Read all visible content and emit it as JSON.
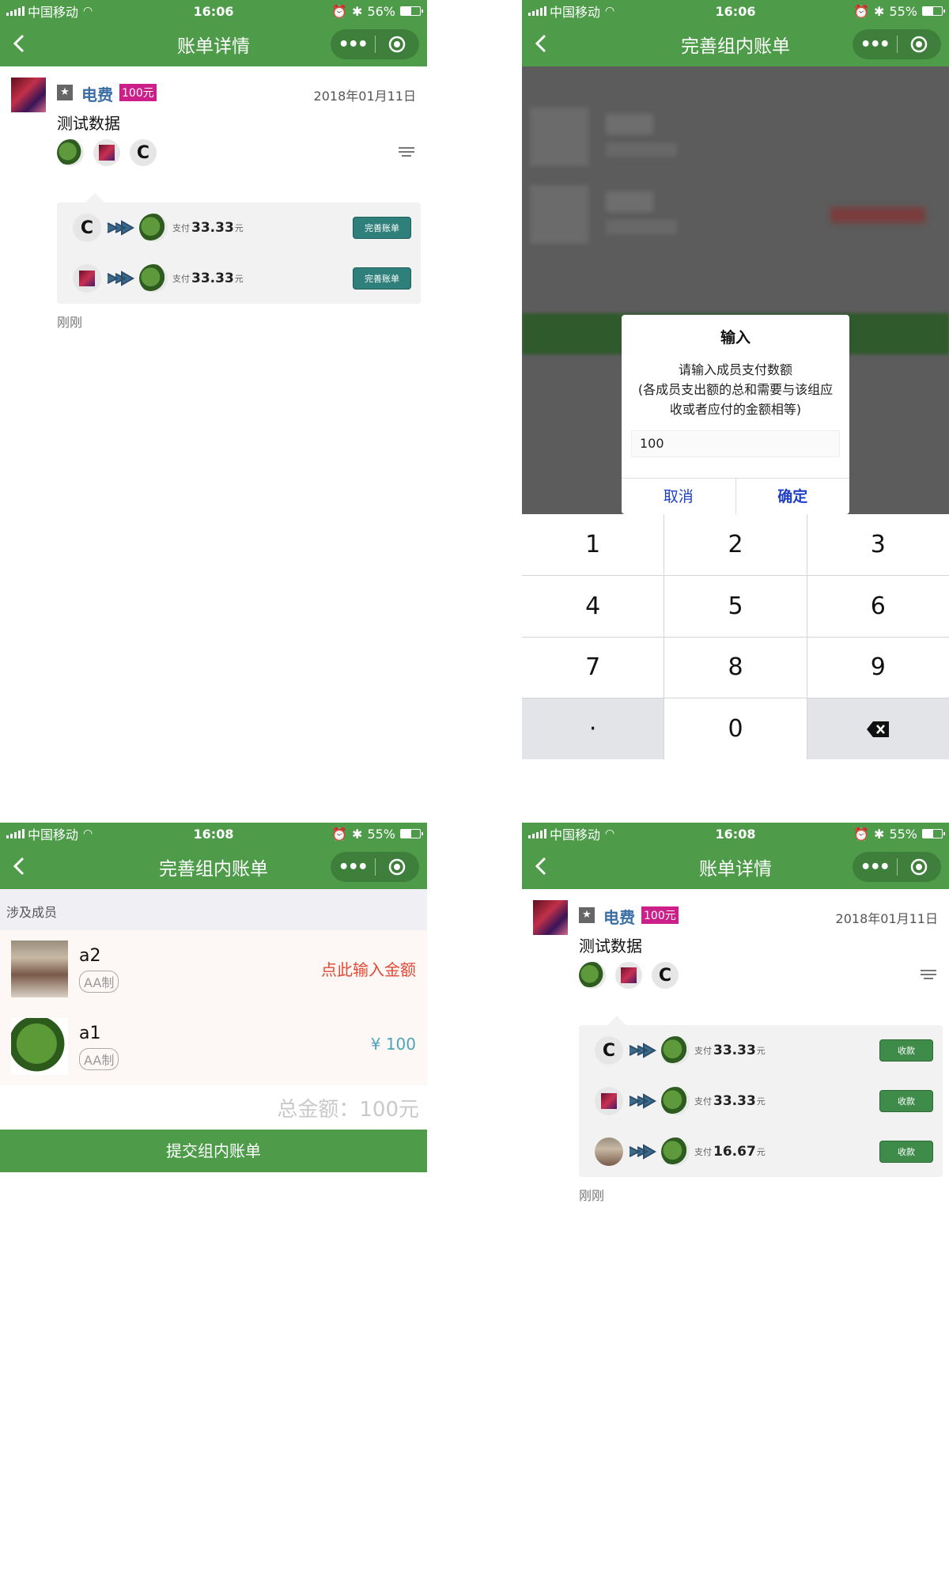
{
  "panels": [
    {
      "status": {
        "carrier": "中国移动",
        "time": "16:06",
        "battery": "56%",
        "battery_level": 0.56
      },
      "nav_title": "账单详情",
      "bill": {
        "category": "电费",
        "amount_badge": "100元",
        "date": "2018年01月11日",
        "description": "测试数据",
        "members": [
          "frog",
          "picture",
          "C"
        ],
        "payments": [
          {
            "from": "C",
            "to": "frog",
            "label": "支付",
            "amount": "33.33",
            "unit": "元",
            "button": "完善账单"
          },
          {
            "from": "picture",
            "to": "frog",
            "label": "支付",
            "amount": "33.33",
            "unit": "元",
            "button": "完善账单"
          }
        ],
        "time_ago": "刚刚"
      }
    },
    {
      "status": {
        "carrier": "中国移动",
        "time": "16:06",
        "battery": "55%",
        "battery_level": 0.55
      },
      "nav_title": "完善组内账单",
      "dialog": {
        "title": "输入",
        "message": "请输入成员支付数额\n(各成员支出额的总和需要与该组应收或者应付的金额相等)",
        "message_line1": "请输入成员支付数额",
        "message_line2": "(各成员支出额的总和需要与该组应",
        "message_line3": "收或者应付的金额相等)",
        "input_value": "100",
        "cancel": "取消",
        "confirm": "确定"
      },
      "keypad": [
        "1",
        "2",
        "3",
        "4",
        "5",
        "6",
        "7",
        "8",
        "9",
        "·",
        "0",
        "backspace"
      ]
    },
    {
      "status": {
        "carrier": "中国移动",
        "time": "16:08",
        "battery": "55%",
        "battery_level": 0.55
      },
      "nav_title": "完善组内账单",
      "section_title": "涉及成员",
      "members": [
        {
          "name": "a2",
          "tag": "AA制",
          "hint": "点此输入金额"
        },
        {
          "name": "a1",
          "tag": "AA制",
          "value": "¥ 100"
        }
      ],
      "total": "总金额：100元",
      "submit": "提交组内账单"
    },
    {
      "status": {
        "carrier": "中国移动",
        "time": "16:08",
        "battery": "55%",
        "battery_level": 0.55
      },
      "nav_title": "账单详情",
      "bill": {
        "category": "电费",
        "amount_badge": "100元",
        "date": "2018年01月11日",
        "description": "测试数据",
        "members": [
          "frog",
          "picture",
          "C"
        ],
        "payments": [
          {
            "from": "C",
            "to": "frog",
            "label": "支付",
            "amount": "33.33",
            "unit": "元",
            "button": "收款"
          },
          {
            "from": "picture",
            "to": "frog",
            "label": "支付",
            "amount": "33.33",
            "unit": "元",
            "button": "收款"
          },
          {
            "from": "person",
            "to": "frog",
            "label": "支付",
            "amount": "16.67",
            "unit": "元",
            "button": "收款"
          }
        ],
        "time_ago": "刚刚"
      }
    }
  ],
  "colors": {
    "brand_green": "#4e9c4a",
    "teal_button": "#2f7f7a",
    "badge_pink": "#cc1f8a",
    "hint_red": "#e14a34",
    "value_teal": "#4aa6b8",
    "dialog_blue": "#1f3fc8"
  }
}
